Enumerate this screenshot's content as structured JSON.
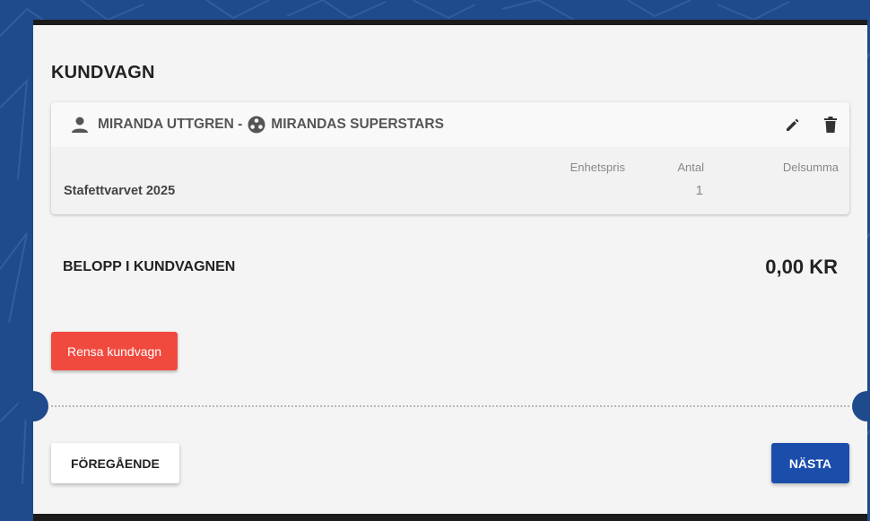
{
  "cart": {
    "title": "KUNDVAGN",
    "participant_name": "MIRANDA UTTGREN -",
    "team_name": "MIRANDAS SUPERSTARS",
    "columns": {
      "unit_price": "Enhetspris",
      "quantity": "Antal",
      "subtotal": "Delsumma"
    },
    "item": {
      "name": "Stafettvarvet 2025",
      "quantity": "1"
    },
    "total_label": "BELOPP I KUNDVAGNEN",
    "total_amount": "0,00 KR",
    "clear_button": "Rensa kundvagn"
  },
  "nav": {
    "previous_button": "FÖREGÅENDE",
    "next_button": "NÄSTA"
  },
  "icons": {
    "participant": "person-icon",
    "team": "team-icon",
    "edit": "pencil-icon",
    "delete": "trash-icon"
  },
  "colors": {
    "background": "#1f4a8c",
    "clear_button": "#f04a3f",
    "next_button": "#1b4dab"
  }
}
